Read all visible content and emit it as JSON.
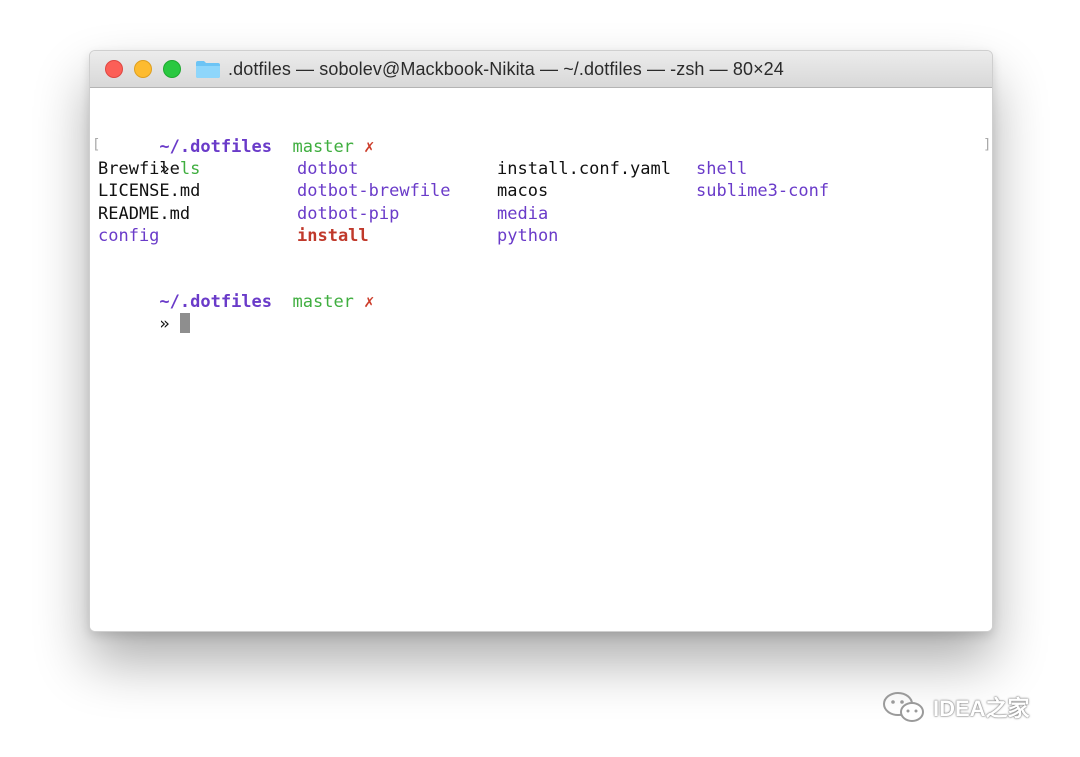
{
  "window": {
    "title": ".dotfiles — sobolev@Mackbook-Nikita — ~/.dotfiles — -zsh — 80×24",
    "buttons": {
      "close": "close",
      "minimize": "minimize",
      "zoom": "zoom"
    },
    "icon": "folder-icon"
  },
  "terminal": {
    "prompt1": {
      "path": "~/.dotfiles",
      "branch": "master",
      "dirty": "✗"
    },
    "command": {
      "marker": "»",
      "text": "ls"
    },
    "ls_rows": [
      [
        "Brewfile",
        "dotbot",
        "install.conf.yaml",
        "shell"
      ],
      [
        "LICENSE.md",
        "dotbot-brewfile",
        "macos",
        "sublime3-conf"
      ],
      [
        "README.md",
        "dotbot-pip",
        "media",
        ""
      ],
      [
        "config",
        "install",
        "python",
        ""
      ]
    ],
    "prompt2": {
      "path": "~/.dotfiles",
      "branch": "master",
      "dirty": "✗"
    },
    "input_marker": "»",
    "left_bracket": "[",
    "right_bracket": "]"
  },
  "colors": {
    "directory": "#6a3bc9",
    "executable": "#c0392b",
    "branch": "#3fae3f",
    "dirty": "#cc3c2a"
  },
  "watermark": {
    "text": "IDEA之家",
    "icon": "wechat-icon"
  }
}
